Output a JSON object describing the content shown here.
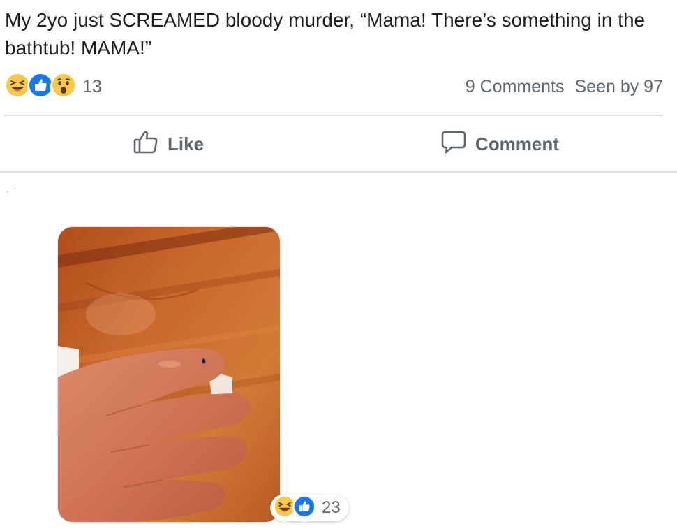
{
  "post": {
    "text": "My 2yo just SCREAMED bloody murder, “Mama! There’s something in the bathtub! MAMA!”"
  },
  "summary": {
    "reaction_icons": [
      "laughing-emoji-icon",
      "like-thumb-icon",
      "wow-emoji-icon"
    ],
    "reaction_count": "13",
    "comments": "9 Comments",
    "seen_by": "Seen by 97"
  },
  "actions": {
    "like_label": "Like",
    "comment_label": "Comment"
  },
  "comment_photo": {
    "reaction_icons": [
      "laughing-emoji-icon",
      "like-thumb-icon"
    ],
    "reaction_count": "23"
  },
  "colors": {
    "text": "#1c1e21",
    "muted": "#606770",
    "divider": "#dadde1",
    "like_blue": "#1877f2",
    "emoji_yellow": "#f7c948"
  }
}
